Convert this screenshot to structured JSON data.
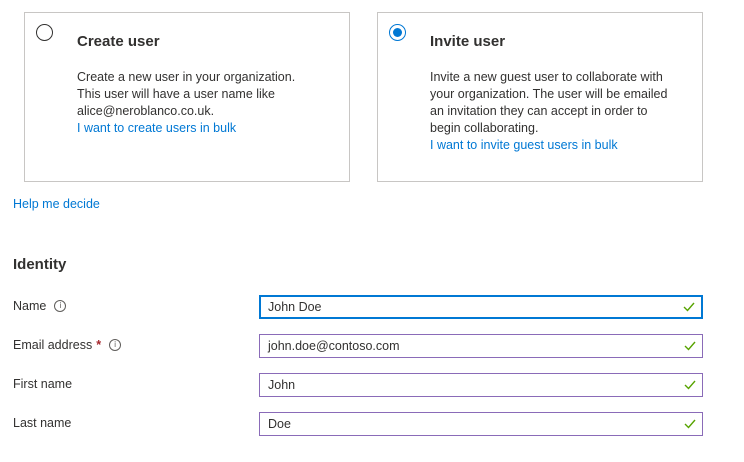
{
  "choices": {
    "create": {
      "title": "Create user",
      "lines": [
        "Create a new user in your organization.",
        "This user will have a user name like",
        "alice@neroblanco.co.uk."
      ],
      "link": "I want to create users in bulk",
      "selected": false
    },
    "invite": {
      "title": "Invite user",
      "lines": [
        "Invite a new guest user to collaborate with",
        "your organization. The user will be emailed",
        "an invitation they can accept in order to",
        "begin collaborating."
      ],
      "link": "I want to invite guest users in bulk",
      "selected": true
    }
  },
  "help_link": "Help me decide",
  "identity": {
    "title": "Identity",
    "fields": [
      {
        "label": "Name",
        "value": "John Doe",
        "required": false,
        "info": true
      },
      {
        "label": "Email address",
        "value": "john.doe@contoso.com",
        "required": true,
        "info": true
      },
      {
        "label": "First name",
        "value": "John",
        "required": false,
        "info": false
      },
      {
        "label": "Last name",
        "value": "Doe",
        "required": false,
        "info": false
      }
    ],
    "required_mark": "*",
    "info_glyph": "i"
  },
  "colors": {
    "accent": "#0078d4",
    "valid": "#57a300",
    "required": "#a4262c",
    "field_border": "#8a6bb8"
  },
  "icons": {
    "radio_selected": "radio-selected-icon",
    "radio_unselected": "radio-unselected-icon",
    "info": "info-icon",
    "valid": "checkmark-icon"
  }
}
